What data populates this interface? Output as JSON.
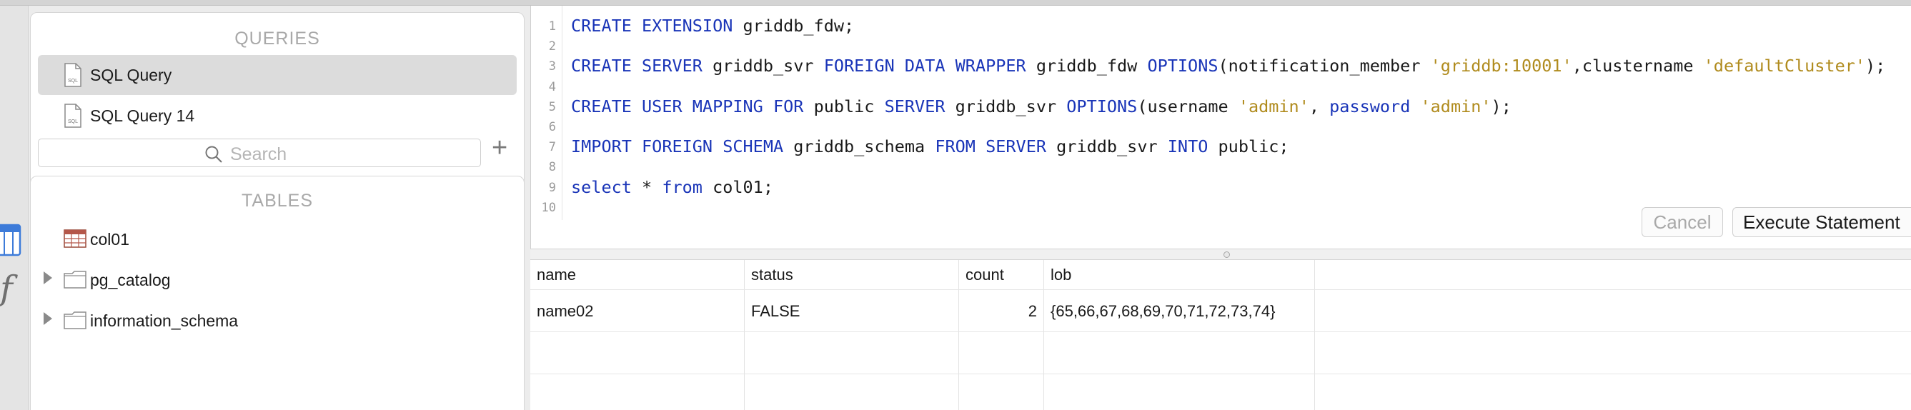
{
  "sidebar": {
    "queries_title": "QUERIES",
    "queries": [
      {
        "label": "SQL Query",
        "active": true,
        "icon": "sql-file-icon"
      },
      {
        "label": "SQL Query 14",
        "active": false,
        "icon": "sql-file-icon"
      }
    ],
    "search": {
      "placeholder": "Search"
    },
    "tables_title": "TABLES",
    "tables": [
      {
        "label": "col01",
        "icon": "table-icon",
        "expandable": false
      },
      {
        "label": "pg_catalog",
        "icon": "folder-icon",
        "expandable": true
      },
      {
        "label": "information_schema",
        "icon": "folder-icon",
        "expandable": true
      }
    ]
  },
  "editor": {
    "line_numbers": [
      "1",
      "2",
      "3",
      "4",
      "5",
      "6",
      "7",
      "8",
      "9",
      "10"
    ],
    "lines": [
      [
        {
          "t": "CREATE EXTENSION",
          "c": "kw"
        },
        {
          "t": " griddb_fdw;",
          "c": ""
        }
      ],
      [],
      [
        {
          "t": "CREATE SERVER",
          "c": "kw"
        },
        {
          "t": " griddb_svr ",
          "c": ""
        },
        {
          "t": "FOREIGN DATA WRAPPER",
          "c": "kw"
        },
        {
          "t": " griddb_fdw ",
          "c": ""
        },
        {
          "t": "OPTIONS",
          "c": "kw"
        },
        {
          "t": "(notification_member ",
          "c": ""
        },
        {
          "t": "'griddb:10001'",
          "c": "str"
        },
        {
          "t": ",clustername ",
          "c": ""
        },
        {
          "t": "'defaultCluster'",
          "c": "str"
        },
        {
          "t": ");",
          "c": ""
        }
      ],
      [],
      [
        {
          "t": "CREATE USER MAPPING FOR",
          "c": "kw"
        },
        {
          "t": " public ",
          "c": ""
        },
        {
          "t": "SERVER",
          "c": "kw"
        },
        {
          "t": " griddb_svr ",
          "c": ""
        },
        {
          "t": "OPTIONS",
          "c": "kw"
        },
        {
          "t": "(username ",
          "c": ""
        },
        {
          "t": "'admin'",
          "c": "str"
        },
        {
          "t": ", ",
          "c": ""
        },
        {
          "t": "password",
          "c": "kw"
        },
        {
          "t": " ",
          "c": ""
        },
        {
          "t": "'admin'",
          "c": "str"
        },
        {
          "t": ");",
          "c": ""
        }
      ],
      [],
      [
        {
          "t": "IMPORT FOREIGN SCHEMA",
          "c": "kw"
        },
        {
          "t": " griddb_schema ",
          "c": ""
        },
        {
          "t": "FROM SERVER",
          "c": "kw"
        },
        {
          "t": " griddb_svr ",
          "c": ""
        },
        {
          "t": "INTO",
          "c": "kw"
        },
        {
          "t": " public;",
          "c": ""
        }
      ],
      [],
      [
        {
          "t": "select",
          "c": "kw"
        },
        {
          "t": " * ",
          "c": ""
        },
        {
          "t": "from",
          "c": "kw"
        },
        {
          "t": " col01;",
          "c": ""
        }
      ],
      []
    ],
    "cancel_label": "Cancel",
    "execute_label": "Execute Statement"
  },
  "results": {
    "columns": [
      "name",
      "status",
      "count",
      "lob"
    ],
    "rows": [
      [
        "name02",
        "FALSE",
        "2",
        "{65,66,67,68,69,70,71,72,73,74}"
      ]
    ]
  },
  "colors": {
    "keyword": "#1a35b8",
    "string": "#b08b1d",
    "accent": "#3d7bd9"
  }
}
